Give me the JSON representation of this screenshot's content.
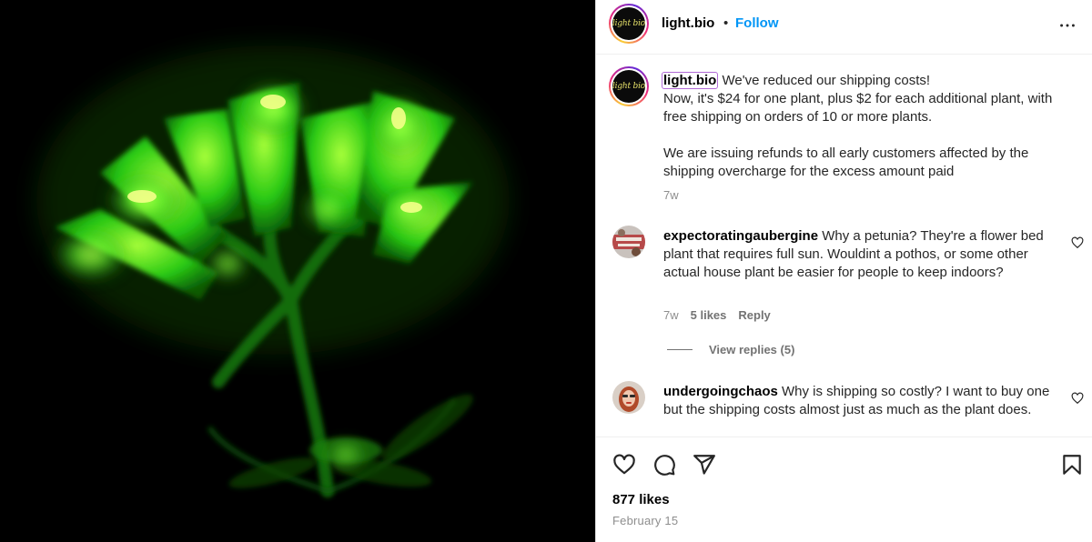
{
  "post": {
    "username": "light.bio",
    "follow_label": "Follow",
    "separator": "•",
    "avatar_text": "light bio"
  },
  "caption": {
    "username": "light.bio",
    "text": "We've reduced our shipping costs!\nNow, it's $24 for one plant, plus $2 for each additional plant, with free shipping on orders of 10 or more plants.\n\nWe are issuing refunds to all early customers affected by the shipping overcharge for the excess amount paid",
    "time": "7w"
  },
  "comments": [
    {
      "username": "expectoratingaubergine",
      "text": "Why a petunia? They're a flower bed plant that requires full sun. Wouldint a pothos, or some other actual house plant be easier for people to keep indoors?",
      "time": "7w",
      "likes": "5 likes",
      "reply_label": "Reply",
      "view_replies": "View replies (5)"
    },
    {
      "username": "undergoingchaos",
      "text": "Why is shipping so costly? I want to buy one but the shipping costs almost just as much as the plant does."
    }
  ],
  "footer": {
    "likes": "877 likes",
    "date": "February 15"
  },
  "icons": {
    "more": "more-options-icon",
    "like": "heart-icon",
    "comment": "comment-icon",
    "share": "share-icon",
    "save": "bookmark-icon"
  },
  "colors": {
    "follow": "#0095f6",
    "glow": "#3cff2a",
    "mention_outline": "#b06ad6"
  }
}
